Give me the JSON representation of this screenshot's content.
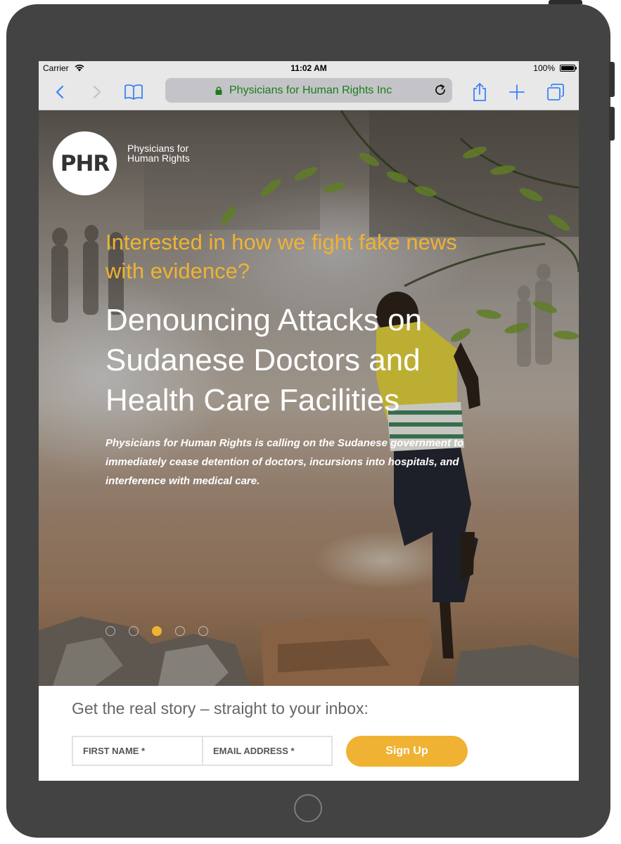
{
  "status_bar": {
    "carrier": "Carrier",
    "time": "11:02 AM",
    "battery": "100%"
  },
  "browser": {
    "url_label": "Physicians for Human Rights Inc",
    "icons": [
      "back-icon",
      "forward-icon",
      "bookmarks-icon",
      "lock-icon",
      "reload-icon",
      "share-icon",
      "new-tab-icon",
      "tabs-icon"
    ]
  },
  "logo": {
    "mark": "PHR",
    "name_line1": "Physicians for",
    "name_line2": "Human Rights"
  },
  "hero": {
    "kicker": "Interested in how we fight fake news with evidence?",
    "headline": "Denouncing Attacks on Sudanese Doctors and Health Care Facilities",
    "summary": "Physicians for Human Rights is calling on the Sudanese government to immediately cease detention of doctors, incursions into hospitals, and interference with medical care.",
    "slides_total": 5,
    "active_slide": 3
  },
  "newsletter": {
    "title": "Get the real story – straight to your inbox:",
    "first_name_placeholder": "FIRST NAME *",
    "email_placeholder": "EMAIL ADDRESS *",
    "button_label": "Sign Up"
  },
  "colors": {
    "accent": "#f0b232",
    "url_green": "#1a7d1a",
    "ios_blue": "#3a82f7",
    "device": "#434343"
  }
}
